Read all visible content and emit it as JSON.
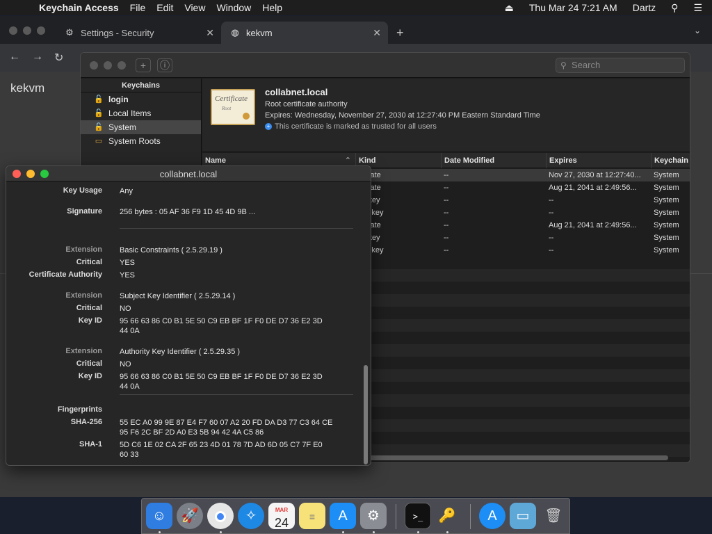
{
  "menubar": {
    "apple": "",
    "app_name": "Keychain Access",
    "menus": [
      "File",
      "Edit",
      "View",
      "Window",
      "Help"
    ],
    "clock": "Thu Mar 24  7:21 AM",
    "user": "Dartz",
    "icons": [
      "eject-icon",
      "search-icon",
      "list-icon"
    ]
  },
  "browser": {
    "tabs": [
      {
        "label": "Settings - Security",
        "icon": "gear-icon"
      },
      {
        "label": "kekvm",
        "icon": "globe-icon"
      }
    ],
    "page_text": "kekvm"
  },
  "keychain": {
    "search_placeholder": "Search",
    "sidebar_header": "Keychains",
    "sidebar_items": [
      {
        "label": "login",
        "icon": "lock-icon"
      },
      {
        "label": "Local Items",
        "icon": "lock-icon"
      },
      {
        "label": "System",
        "icon": "lock-icon"
      },
      {
        "label": "System Roots",
        "icon": "folder-icon"
      }
    ],
    "cert": {
      "image_line1": "Certificate",
      "image_line2": "Root",
      "title": "collabnet.local",
      "subtitle": "Root certificate authority",
      "expires": "Expires: Wednesday, November 27, 2030 at 12:27:40 PM Eastern Standard Time",
      "trust": "This certificate is marked as trusted for all users"
    },
    "columns": [
      "Name",
      "Kind",
      "Date Modified",
      "Expires",
      "Keychain"
    ],
    "rows": [
      {
        "kind": "tificate",
        "modified": "--",
        "expires": "Nov 27, 2030 at 12:27:40...",
        "keychain": "System"
      },
      {
        "kind": "tificate",
        "modified": "--",
        "expires": "Aug 21, 2041 at 2:49:56...",
        "keychain": "System"
      },
      {
        "kind": "lic key",
        "modified": "--",
        "expires": "--",
        "keychain": "System"
      },
      {
        "kind": "ate key",
        "modified": "--",
        "expires": "--",
        "keychain": "System"
      },
      {
        "kind": "tificate",
        "modified": "--",
        "expires": "Aug 21, 2041 at 2:49:56...",
        "keychain": "System"
      },
      {
        "kind": "lic key",
        "modified": "--",
        "expires": "--",
        "keychain": "System"
      },
      {
        "kind": "ate key",
        "modified": "--",
        "expires": "--",
        "keychain": "System"
      }
    ]
  },
  "detail": {
    "title": "collabnet.local",
    "fields": [
      {
        "label": "Key Usage",
        "value": "Any"
      },
      {
        "label": "Signature",
        "value": "256 bytes : 05 AF 36 F9 1D 45 4D 9B ..."
      },
      {
        "label": "Extension",
        "value": "Basic Constraints ( 2.5.29.19 )"
      },
      {
        "label": "Critical",
        "value": "YES"
      },
      {
        "label": "Certificate Authority",
        "value": "YES"
      },
      {
        "label": "Extension",
        "value": "Subject Key Identifier ( 2.5.29.14 )"
      },
      {
        "label": "Critical",
        "value": "NO"
      },
      {
        "label": "Key ID",
        "value": "95 66 63 86 C0 B1 5E 50 C9 EB BF 1F F0 DE D7 36 E2 3D",
        "value2": "44 0A"
      },
      {
        "label": "Extension",
        "value": "Authority Key Identifier ( 2.5.29.35 )"
      },
      {
        "label": "Critical",
        "value": "NO"
      },
      {
        "label": "Key ID",
        "value": "95 66 63 86 C0 B1 5E 50 C9 EB BF 1F F0 DE D7 36 E2 3D",
        "value2": "44 0A"
      },
      {
        "label": "Fingerprints",
        "value": ""
      },
      {
        "label": "SHA-256",
        "value": "55 EC A0 99 9E 87 E4 F7 60 07 A2 20 FD DA D3 77 C3 64 CE",
        "value2": "95 F6 2C BF 2D A0 E3 5B 94 42 4A C5 86"
      },
      {
        "label": "SHA-1",
        "value": "5D C6 1E 02 CA 2F 65 23 4D 01 78 7D AD 6D 05 C7 7F E0",
        "value2": "60 33"
      }
    ]
  },
  "dock": {
    "items": [
      "finder-icon",
      "launchpad-icon",
      "chrome-icon",
      "safari-icon",
      "calendar-icon",
      "notes-icon",
      "app-store-icon",
      "system-preferences-icon",
      "terminal-icon",
      "keychain-access-icon",
      "app-store-icon",
      "downloads-folder-icon",
      "trash-icon"
    ],
    "calendar_month": "MAR",
    "calendar_day": "24"
  },
  "colors": {
    "close": "#ff5f57",
    "minimize": "#febc2e",
    "zoom": "#28c840",
    "trust_badge": "#3b8df0"
  }
}
